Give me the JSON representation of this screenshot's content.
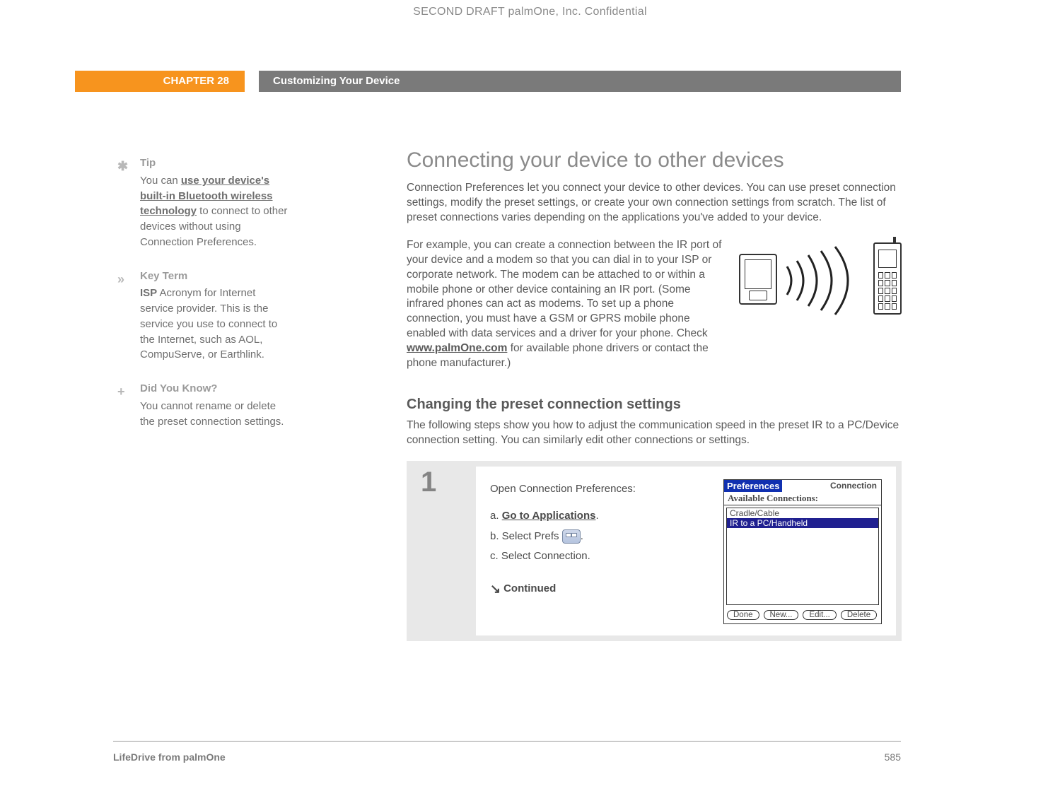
{
  "confidential": "SECOND DRAFT palmOne, Inc.  Confidential",
  "header": {
    "chapter": "CHAPTER 28",
    "title": "Customizing Your Device"
  },
  "sidebar": {
    "tip": {
      "head": "Tip",
      "pre": "You can ",
      "link": "use your device's built-in Bluetooth wireless technology",
      "post": " to connect to other devices without using Connection Preferences."
    },
    "keyterm": {
      "head": "Key Term",
      "term": "ISP",
      "def": "   Acronym for Internet service provider. This is the service you use to connect to the Internet, such as AOL, CompuServe, or Earthlink."
    },
    "dyk": {
      "head": "Did You Know?",
      "body": "You cannot rename or delete the preset connection settings."
    }
  },
  "main": {
    "h1": "Connecting your device to other devices",
    "p1": "Connection Preferences let you connect your device to other devices. You can use preset connection settings, modify the preset settings, or create your own connection settings from scratch. The list of preset connections varies depending on the applications you've added to your device.",
    "p2a": "For example, you can create a connection between the IR port of your device and a modem so that you can dial in to your ISP or corporate network. The modem can be attached to or within a mobile phone or other device containing an IR port. (Some infrared phones can act as modems. To set up a phone connection, you must have a GSM or GPRS mobile phone enabled with data services and a driver for your phone. Check ",
    "p2link": "www.palmOne.com",
    "p2b": " for available phone drivers or contact the phone manufacturer.)",
    "h2": "Changing the preset connection settings",
    "p3": "The following steps show you how to adjust the communication speed in the preset IR to a PC/Device connection setting. You can similarly edit other connections or settings."
  },
  "step": {
    "num": "1",
    "lead": "Open Connection Preferences:",
    "a_pre": "a.  ",
    "a_link": "Go to Applications",
    "a_post": ".",
    "b_pre": "b.  Select Prefs ",
    "b_post": ".",
    "c": "c.  Select Connection.",
    "continued": "Continued"
  },
  "mini": {
    "prefs": "Preferences",
    "conn": "Connection",
    "avail": "Available Connections:",
    "row1": "Cradle/Cable",
    "row2": "IR to a PC/Handheld",
    "btns": [
      "Done",
      "New...",
      "Edit...",
      "Delete"
    ]
  },
  "footer": {
    "brand": "LifeDrive from palmOne",
    "page": "585"
  }
}
